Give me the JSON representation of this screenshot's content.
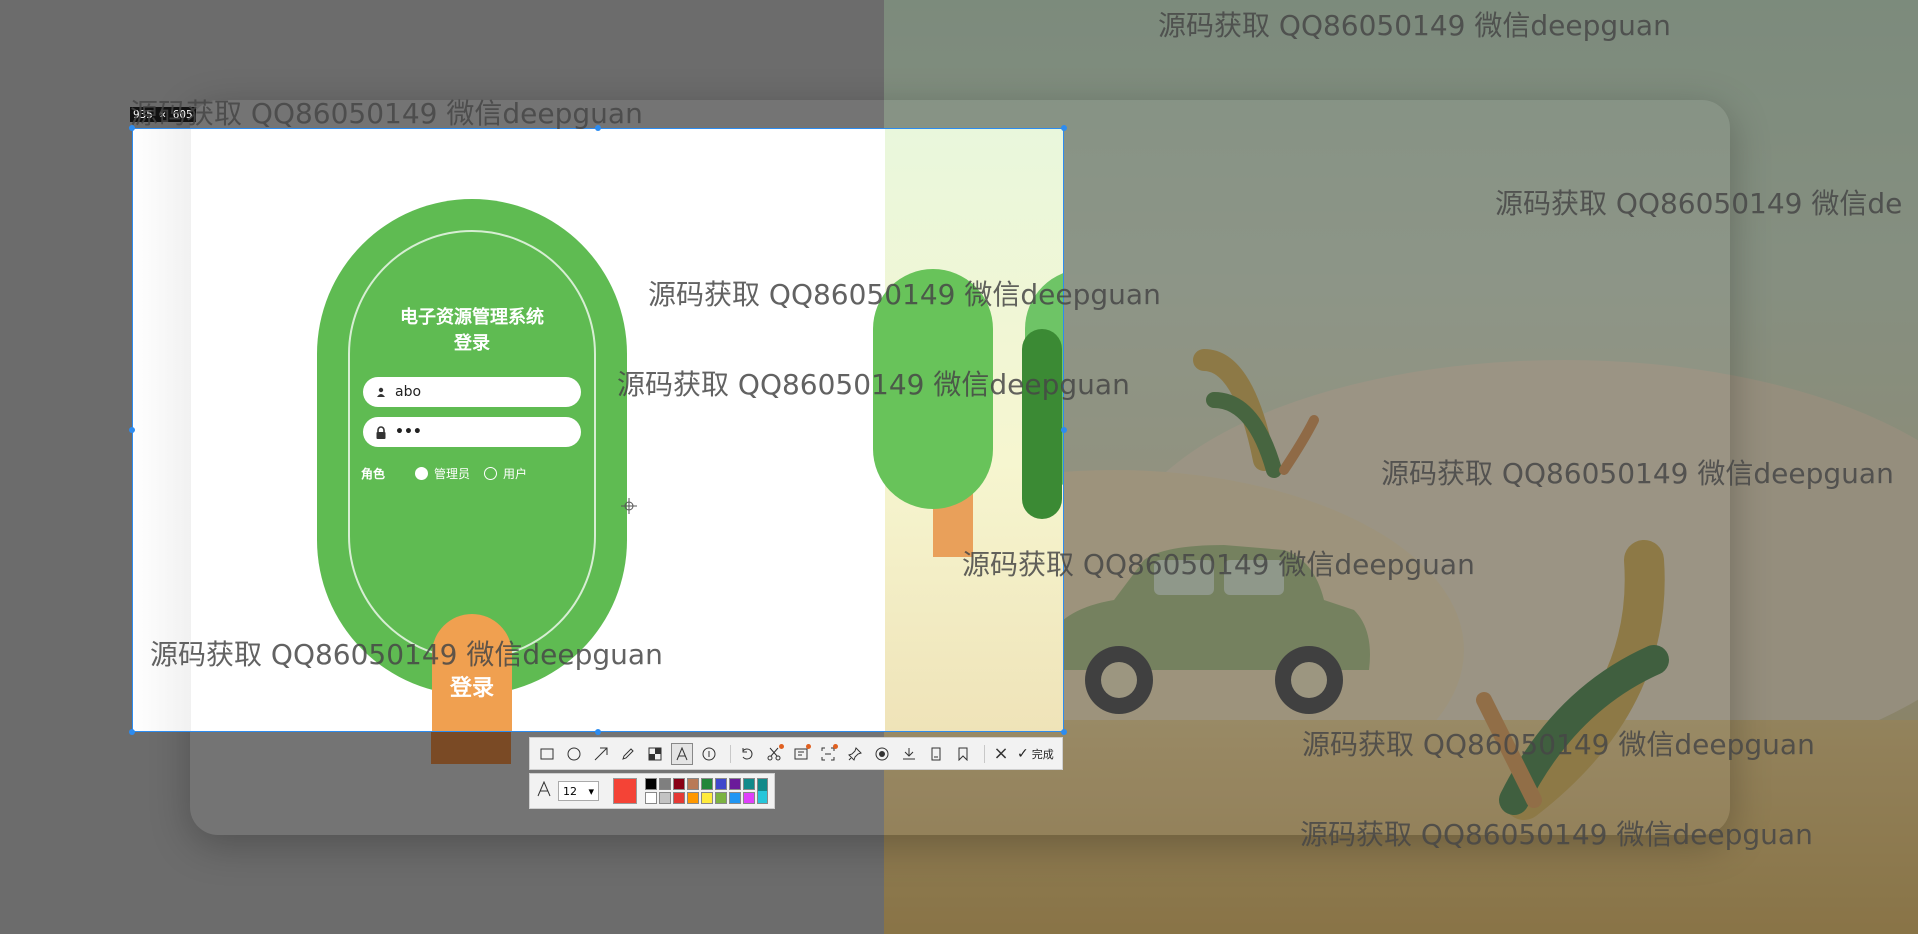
{
  "capture": {
    "size_label": "935 × 605"
  },
  "login": {
    "title_line1": "电子资源管理系统",
    "title_line2": "登录",
    "username_value": "abo",
    "password_value": "•••",
    "role_label": "角色",
    "role_options": [
      "管理员",
      "用户"
    ],
    "role_selected": "管理员",
    "submit_label": "登录"
  },
  "toolbar": {
    "tools": [
      "rectangle-icon",
      "ellipse-icon",
      "arrow-icon",
      "pencil-icon",
      "mosaic-icon",
      "text-icon",
      "number-icon",
      "undo-icon",
      "cut-icon",
      "ocr-icon",
      "scroll-capture-icon",
      "pin-icon",
      "record-icon",
      "save-icon",
      "copy-icon",
      "bookmark-icon"
    ],
    "active_tool": "text-icon",
    "close_label": "×",
    "done_label": "完成"
  },
  "text_options": {
    "font_size": "12",
    "current_color": "#f44336",
    "palette": [
      "#000000",
      "#7f7f7f",
      "#880015",
      "#b97a57",
      "#22863a",
      "#3f48cc",
      "#6b1b9a",
      "#118a8a",
      "#ffffff",
      "#c3c3c3",
      "#e53935",
      "#ff9800",
      "#ffeb3b",
      "#7cb342",
      "#2196f3",
      "#e040fb",
      "#26c6da"
    ]
  },
  "watermarks": [
    "源码获取 QQ86050149 微信deepguan",
    "源码获取 QQ86050149 微信deepguan",
    "源码获取 QQ86050149 微信de",
    "源码获取 QQ86050149 微信deepguan",
    "源码获取 QQ86050149 微信deepguan",
    "源码获取 QQ86050149 微信deepguan",
    "源码获取 QQ86050149 微信deepguan",
    "源码获取 QQ86050149 微信deepguan",
    "源码获取 QQ86050149 微信deepguan",
    "源码获取 QQ86050149 微信deepguan"
  ]
}
